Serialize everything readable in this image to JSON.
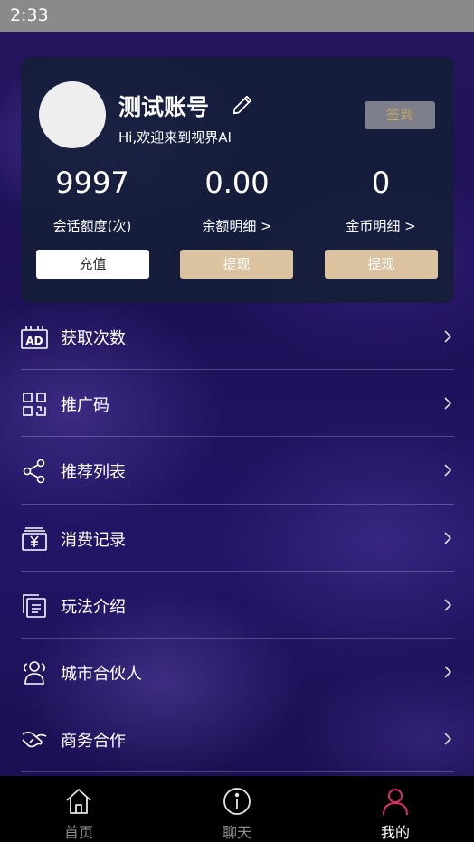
{
  "status_bar": {
    "time": "2:33"
  },
  "profile": {
    "name": "测试账号",
    "greeting": "Hi,欢迎来到视界AI",
    "signin_label": "签到"
  },
  "stats": [
    {
      "value": "9997",
      "label": "会话额度(次)",
      "button": "充值"
    },
    {
      "value": "0.00",
      "label": "余额明细 >",
      "button": "提现"
    },
    {
      "value": "0",
      "label": "金币明细 >",
      "button": "提现"
    }
  ],
  "menu": [
    {
      "label": "获取次数",
      "icon": "ad-icon"
    },
    {
      "label": "推广码",
      "icon": "qr-code-icon"
    },
    {
      "label": "推荐列表",
      "icon": "share-icon"
    },
    {
      "label": "消费记录",
      "icon": "yuan-receipt-icon"
    },
    {
      "label": "玩法介绍",
      "icon": "document-icon"
    },
    {
      "label": "城市合伙人",
      "icon": "people-icon"
    },
    {
      "label": "商务合作",
      "icon": "handshake-icon"
    }
  ],
  "tabs": [
    {
      "label": "首页",
      "icon": "home-icon",
      "active": false
    },
    {
      "label": "聊天",
      "icon": "info-icon",
      "active": false
    },
    {
      "label": "我的",
      "icon": "person-icon",
      "active": true
    }
  ],
  "colors": {
    "accent": "#e0306a",
    "gold_button": "#dcc3a0",
    "signin_text": "#c7a86a",
    "tab_inactive": "#8c8c8c"
  }
}
